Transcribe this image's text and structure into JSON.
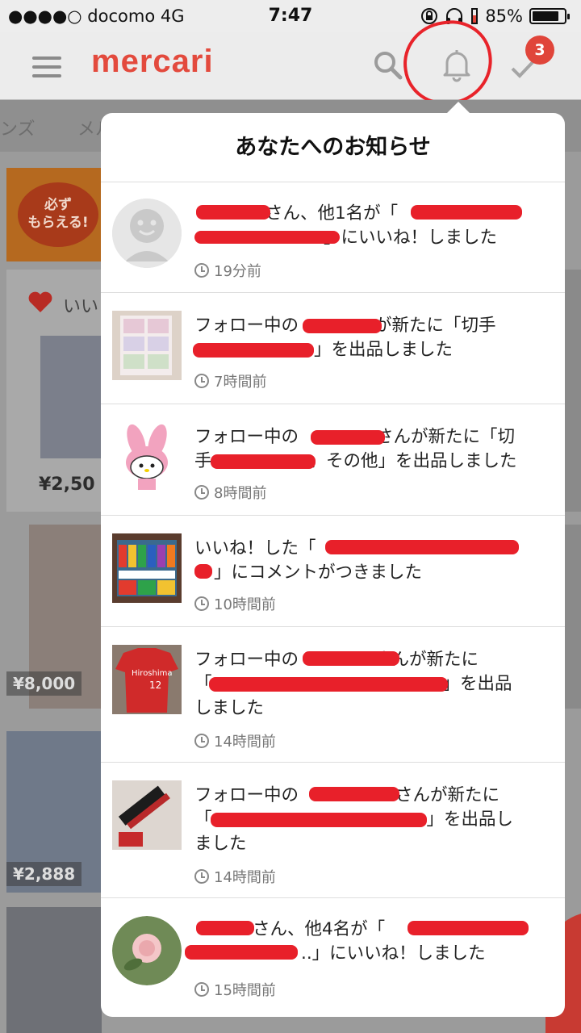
{
  "status_bar": {
    "carrier": "●●●●○ docomo   4G",
    "time": "7:47",
    "battery_pct": "85%",
    "battery_level": 0.85
  },
  "header": {
    "logo": "mercari",
    "badge_count": "3"
  },
  "background": {
    "tab_left": "ンズ",
    "tab_right": "メル",
    "promo_text_1": "必ず",
    "promo_text_2": "もらえる!",
    "likes_label": "いい",
    "price_1": "¥2,50",
    "price_2": "¥8,000",
    "price_3": "¥2,888"
  },
  "popover": {
    "title": "あなたへのお知らせ",
    "items": [
      {
        "text_a": "さん、他1名が「",
        "text_b": "」にいいね！しました",
        "time": "19分前",
        "thumb": "default-avatar"
      },
      {
        "text_a": "フォロー中の",
        "text_b": "が新たに「切手",
        "text_c": "」を出品しました",
        "time": "7時間前",
        "thumb": "stamps-photo"
      },
      {
        "text_a": "フォロー中の",
        "text_b": "さんが新たに「切",
        "text_c": "手",
        "text_d": "、その他」を出品しました",
        "time": "8時間前",
        "thumb": "character-photo"
      },
      {
        "text_a": "いいね！した「",
        "text_b": "」にコメントがつきました",
        "time": "10時間前",
        "thumb": "pencils-photo"
      },
      {
        "text_a": "フォロー中の",
        "text_b": "さんが新たに",
        "text_c": "「",
        "text_d": "」を出品",
        "text_e": "しました",
        "time": "14時間前",
        "thumb": "jersey-photo"
      },
      {
        "text_a": "フォロー中の",
        "text_b": "さんが新たに",
        "text_c": "「",
        "text_d": "」を出品し",
        "text_e": "ました",
        "time": "14時間前",
        "thumb": "pen-photo"
      },
      {
        "text_a": "さん、他4名が「",
        "text_b": "..」にいいね！しました",
        "time": "15時間前",
        "thumb": "rose-photo"
      }
    ]
  },
  "colors": {
    "brand": "#e34a3d",
    "badge": "#e0453a",
    "redaction": "#e8202a"
  }
}
